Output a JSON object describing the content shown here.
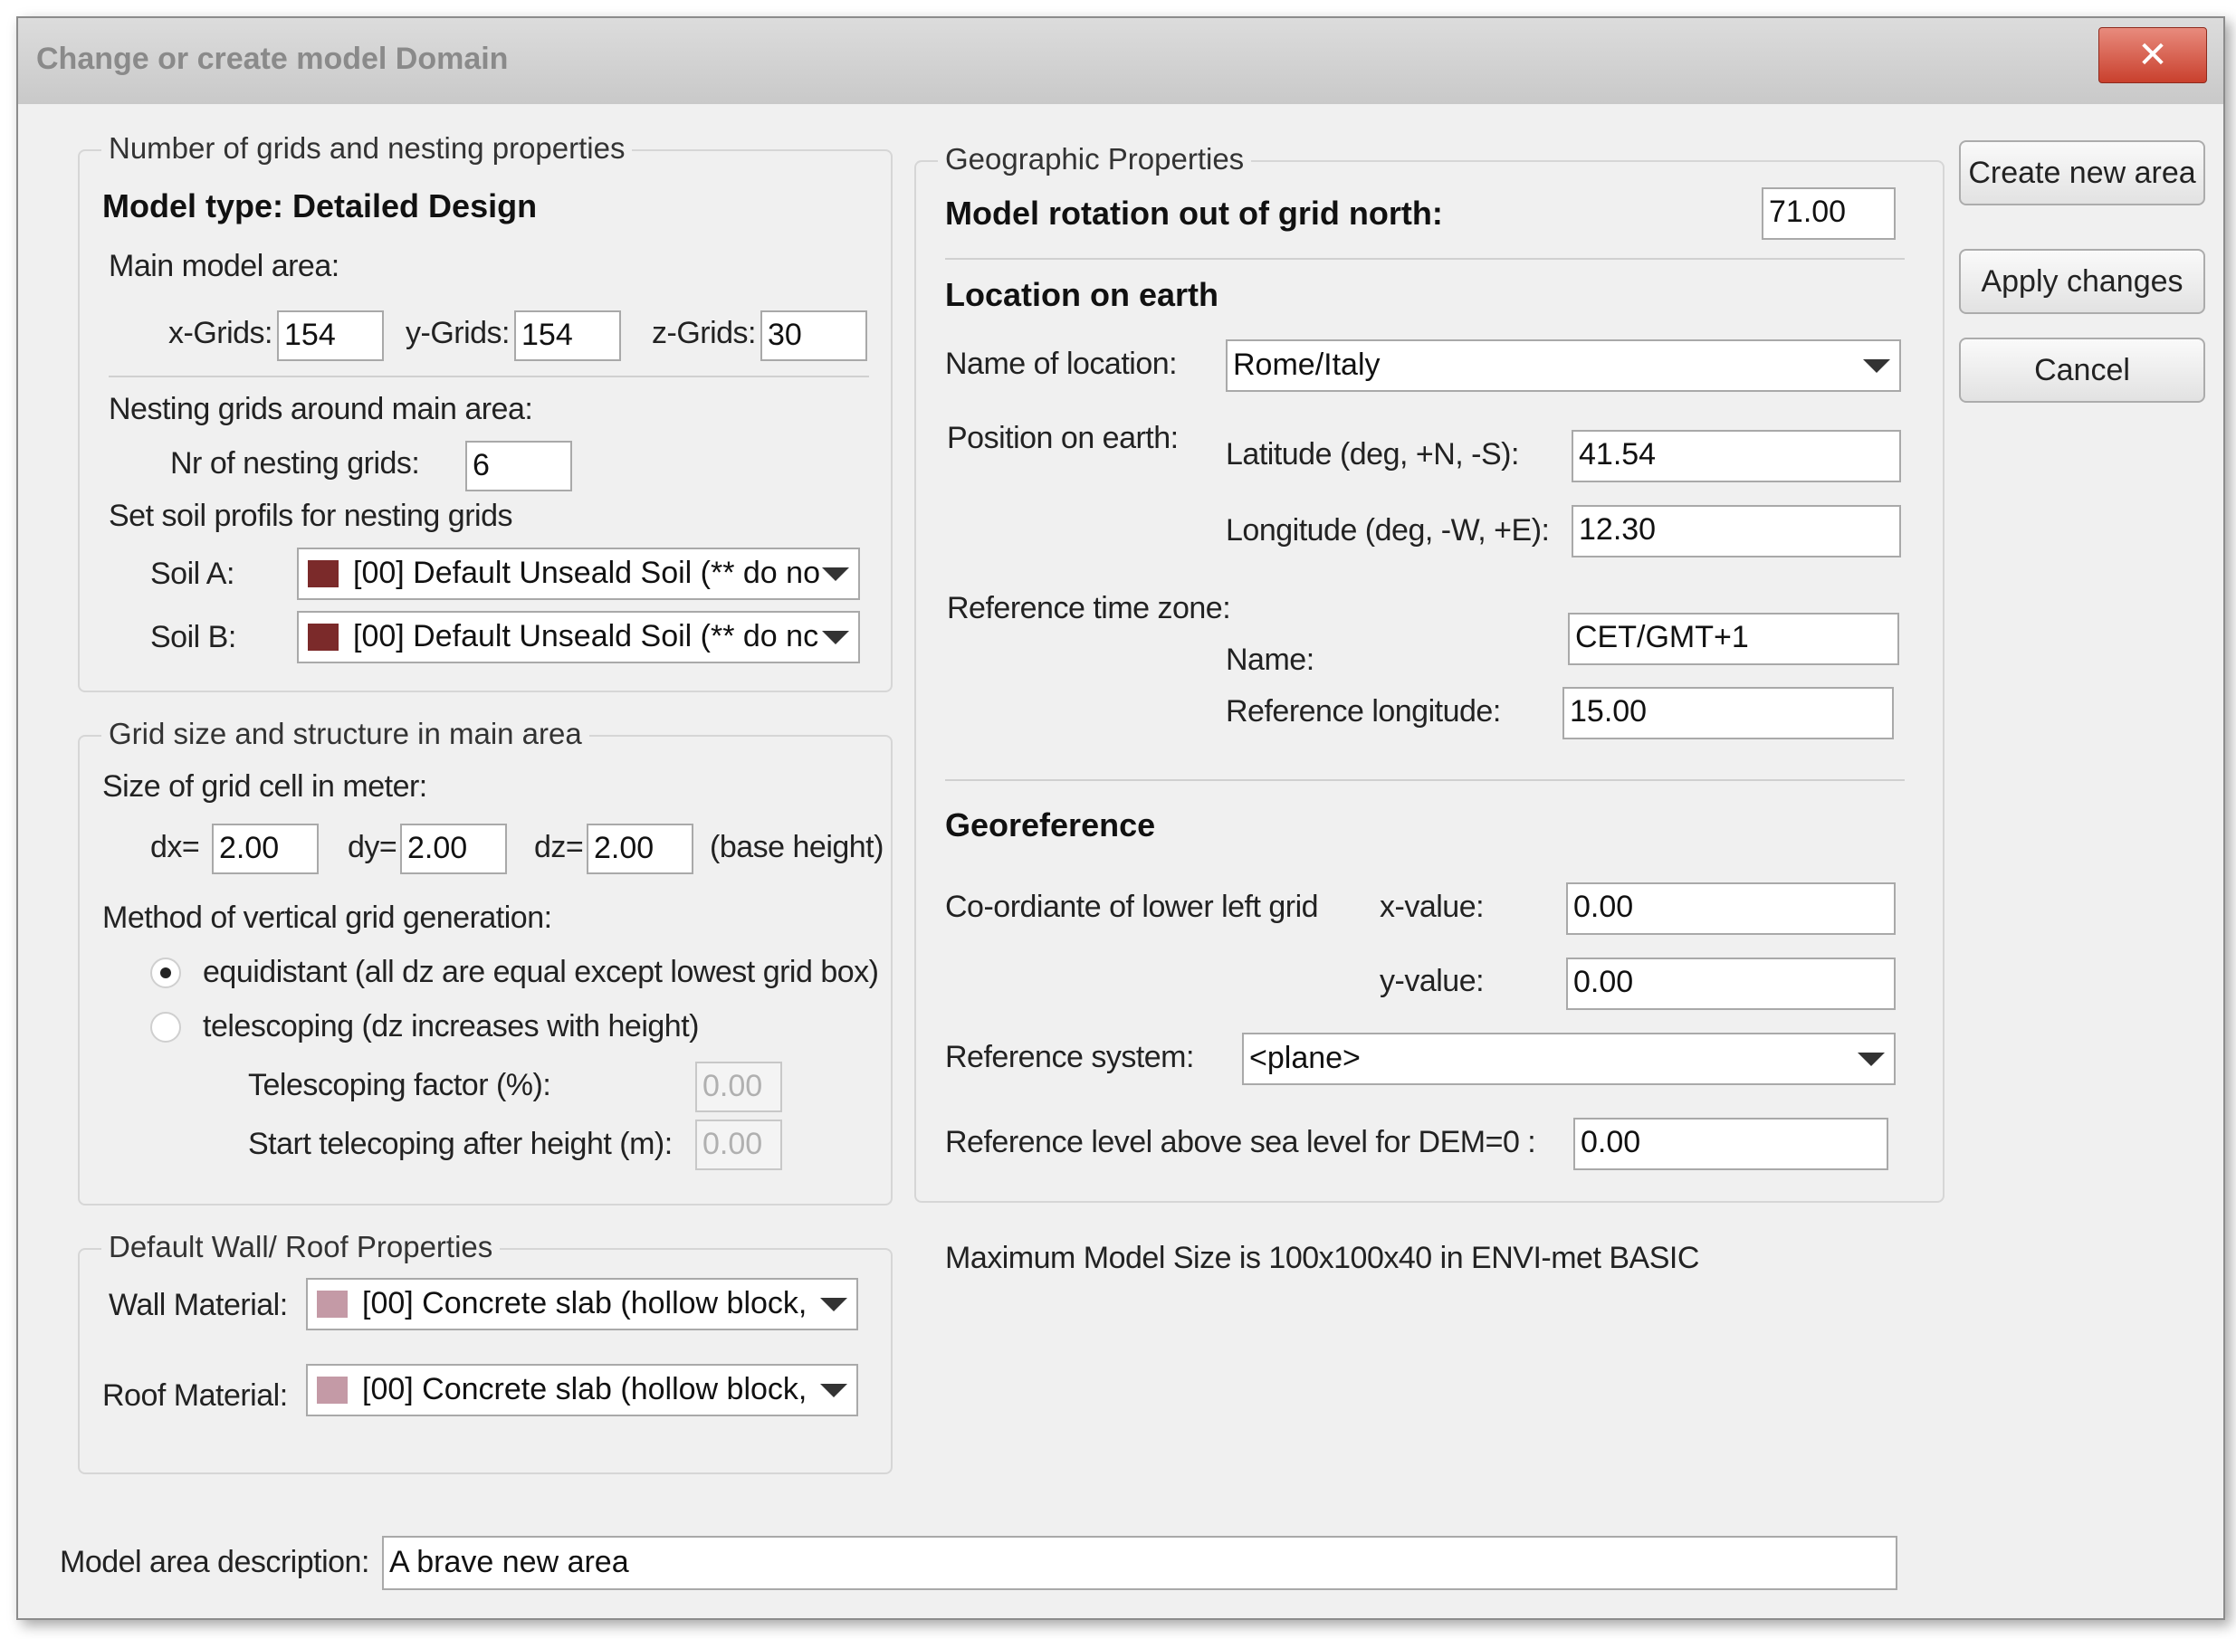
{
  "window": {
    "title": "Change or create model Domain",
    "close_label": "✕"
  },
  "buttons": {
    "create": "Create new area",
    "apply": "Apply changes",
    "cancel": "Cancel"
  },
  "nesting": {
    "legend": "Number of grids and nesting properties",
    "model_type": "Model type: Detailed Design",
    "main_area_label": "Main model area:",
    "x_label": "x-Grids:",
    "x_value": "154",
    "y_label": "y-Grids:",
    "y_value": "154",
    "z_label": "z-Grids:",
    "z_value": "30",
    "nesting_label": "Nesting grids around main area:",
    "nr_label": "Nr of nesting grids:",
    "nr_value": "6",
    "soil_profiles_label": "Set soil profils for nesting grids",
    "soil_a_label": "Soil A:",
    "soil_a_value": "[00] Default Unseald Soil (** do no",
    "soil_b_label": "Soil B:",
    "soil_b_value": "[00] Default Unseald Soil (** do nc",
    "soil_color": "#7b2a2a"
  },
  "grid": {
    "legend": "Grid size and structure in main area",
    "size_label": "Size of grid cell in meter:",
    "dx_label": "dx=",
    "dx_value": "2.00",
    "dy_label": "dy=",
    "dy_value": "2.00",
    "dz_label": "dz=",
    "dz_value": "2.00",
    "base_height": "(base height)",
    "method_label": "Method of vertical grid generation:",
    "equidistant": "equidistant (all dz are equal except lowest grid box)",
    "telescoping": "telescoping (dz increases with height)",
    "selected_method": "equidistant",
    "factor_label": "Telescoping factor (%):",
    "factor_value": "0.00",
    "start_label": "Start telecoping after height (m):",
    "start_value": "0.00"
  },
  "wall": {
    "legend": "Default Wall/ Roof Properties",
    "wall_label": "Wall Material:",
    "wall_value": "[00] Concrete slab (hollow block,",
    "roof_label": "Roof Material:",
    "roof_value": "[00] Concrete slab (hollow block,",
    "material_color": "#c49aa6"
  },
  "geo": {
    "legend": "Geographic Properties",
    "rotation_label": "Model rotation out of grid north:",
    "rotation_value": "71.00",
    "location_heading": "Location on earth",
    "name_label": "Name of location:",
    "name_value": "Rome/Italy",
    "position_label": "Position on earth:",
    "lat_label": "Latitude (deg, +N, -S):",
    "lat_value": "41.54",
    "lon_label": "Longitude (deg, -W, +E):",
    "lon_value": "12.30",
    "tz_label": "Reference time zone:",
    "tz_name_label": "Name:",
    "tz_name_value": "CET/GMT+1",
    "ref_lon_label": "Reference longitude:",
    "ref_lon_value": "15.00",
    "georef_heading": "Georeference",
    "coord_label": "Co-ordiante of lower left grid",
    "xval_label": "x-value:",
    "xval_value": "0.00",
    "yval_label": "y-value:",
    "yval_value": "0.00",
    "refsys_label": "Reference system:",
    "refsys_value": "<plane>",
    "dem_label": "Reference level above sea level for DEM=0 :",
    "dem_value": "0.00"
  },
  "max_size_note": "Maximum Model Size is 100x100x40 in ENVI-met BASIC",
  "description": {
    "label": "Model area description:",
    "value": "A brave new area"
  }
}
